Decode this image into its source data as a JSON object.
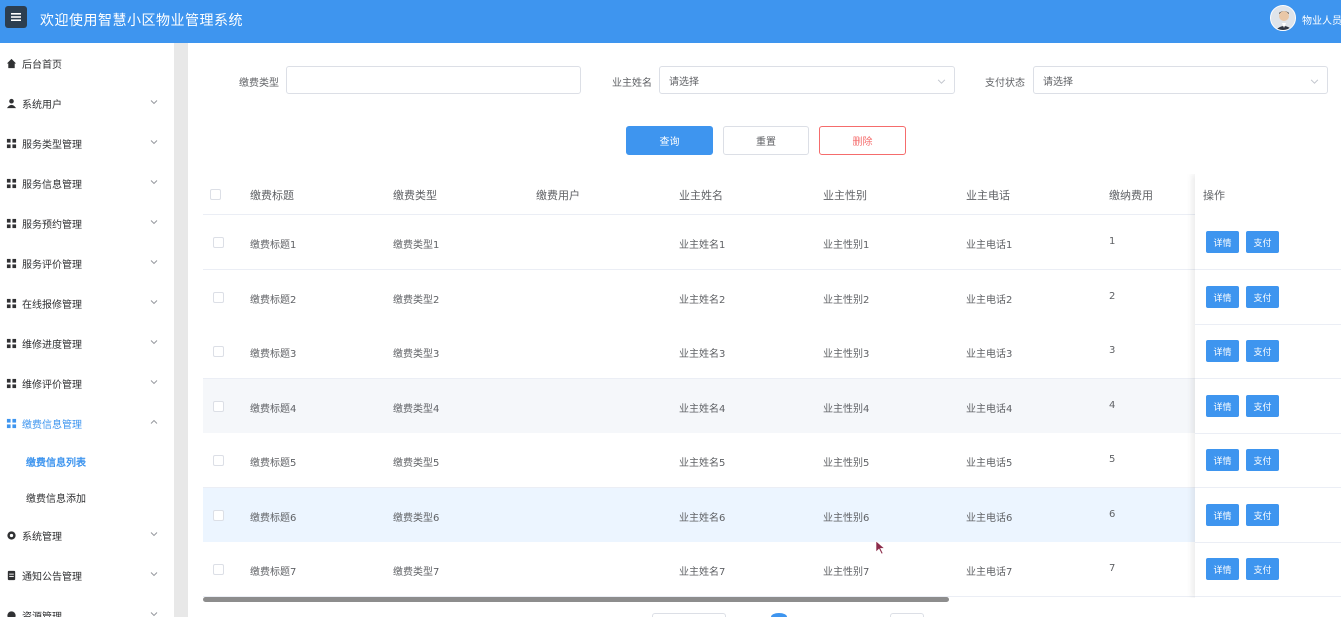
{
  "header": {
    "title": "欢迎使用智慧小区物业管理系统",
    "user_name": "物业人员",
    "menu_icon": "menu-icon",
    "color": "#3e95ef"
  },
  "sidebar": {
    "items": [
      {
        "label": "后台首页",
        "icon": "home-icon",
        "expandable": false
      },
      {
        "label": "系统用户",
        "icon": "user-icon",
        "expandable": true
      },
      {
        "label": "服务类型管理",
        "icon": "grid-icon",
        "expandable": true
      },
      {
        "label": "服务信息管理",
        "icon": "grid-icon",
        "expandable": true
      },
      {
        "label": "服务预约管理",
        "icon": "grid-icon",
        "expandable": true
      },
      {
        "label": "服务评价管理",
        "icon": "grid-icon",
        "expandable": true
      },
      {
        "label": "在线报修管理",
        "icon": "grid-icon",
        "expandable": true
      },
      {
        "label": "维修进度管理",
        "icon": "grid-icon",
        "expandable": true
      },
      {
        "label": "维修评价管理",
        "icon": "grid-icon",
        "expandable": true
      },
      {
        "label": "缴费信息管理",
        "icon": "grid-icon",
        "expandable": true,
        "active": true,
        "children": [
          "缴费信息列表",
          "缴费信息添加"
        ]
      },
      {
        "label": "系统管理",
        "icon": "gear-icon",
        "expandable": true
      },
      {
        "label": "通知公告管理",
        "icon": "document-icon",
        "expandable": true
      },
      {
        "label": "资源管理",
        "icon": "folder-icon",
        "expandable": true
      }
    ]
  },
  "filters": {
    "fee_type_label": "缴费类型",
    "fee_type_value": "",
    "owner_name_label": "业主姓名",
    "owner_name_placeholder": "请选择",
    "pay_status_label": "支付状态",
    "pay_status_placeholder": "请选择"
  },
  "actions": {
    "query": "查询",
    "reset": "重置",
    "delete": "删除"
  },
  "table": {
    "columns": [
      "缴费标题",
      "缴费类型",
      "缴费用户",
      "业主姓名",
      "业主性别",
      "业主电话",
      "缴纳费用",
      "操作"
    ],
    "rows": [
      {
        "title": "缴费标题1",
        "type": "缴费类型1",
        "user": "",
        "name": "业主姓名1",
        "gender": "业主性别1",
        "phone": "业主电话1",
        "fee": "1"
      },
      {
        "title": "缴费标题2",
        "type": "缴费类型2",
        "user": "",
        "name": "业主姓名2",
        "gender": "业主性别2",
        "phone": "业主电话2",
        "fee": "2"
      },
      {
        "title": "缴费标题3",
        "type": "缴费类型3",
        "user": "",
        "name": "业主姓名3",
        "gender": "业主性别3",
        "phone": "业主电话3",
        "fee": "3"
      },
      {
        "title": "缴费标题4",
        "type": "缴费类型4",
        "user": "",
        "name": "业主姓名4",
        "gender": "业主性别4",
        "phone": "业主电话4",
        "fee": "4"
      },
      {
        "title": "缴费标题5",
        "type": "缴费类型5",
        "user": "",
        "name": "业主姓名5",
        "gender": "业主性别5",
        "phone": "业主电话5",
        "fee": "5"
      },
      {
        "title": "缴费标题6",
        "type": "缴费类型6",
        "user": "",
        "name": "业主姓名6",
        "gender": "业主性别6",
        "phone": "业主电话6",
        "fee": "6"
      },
      {
        "title": "缴费标题7",
        "type": "缴费类型7",
        "user": "",
        "name": "业主姓名7",
        "gender": "业主性别7",
        "phone": "业主电话7",
        "fee": "7"
      }
    ],
    "row_actions": {
      "detail": "详情",
      "pay": "支付"
    }
  }
}
